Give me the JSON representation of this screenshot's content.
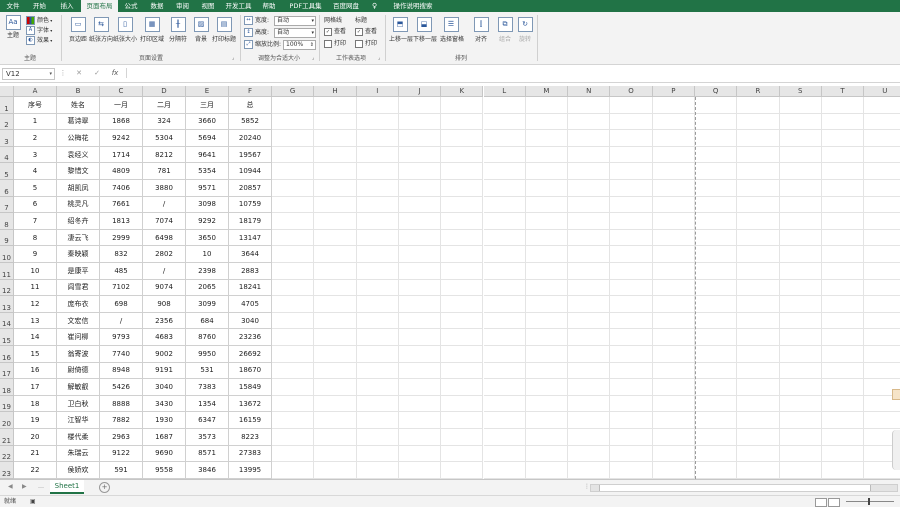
{
  "ribbon": {
    "tabs": [
      "文件",
      "开始",
      "插入",
      "页面布局",
      "公式",
      "数据",
      "审阅",
      "视图",
      "开发工具",
      "帮助",
      "PDF工具集",
      "百度网盘",
      "操作说明搜索"
    ],
    "active_tab": "页面布局",
    "theme_group": {
      "label": "主题",
      "themes_button": "主题",
      "colors": "颜色",
      "fonts": "字体",
      "effects": "效果"
    },
    "page_setup_group": {
      "label": "页面设置",
      "buttons": [
        "页边距",
        "纸张方向",
        "纸张大小",
        "打印区域",
        "分隔符",
        "背景",
        "打印标题"
      ]
    },
    "scale_group": {
      "label": "调整为合适大小",
      "width_label": "宽度:",
      "width_value": "自动",
      "height_label": "高度:",
      "height_value": "自动",
      "scale_label": "缩放比例:",
      "scale_value": "100%"
    },
    "sheet_options_group": {
      "label": "工作表选项",
      "gridlines": "网格线",
      "headings": "标题",
      "view": "查看",
      "print": "打印"
    },
    "arrange_group": {
      "label": "排列",
      "buttons": [
        "上移一层",
        "下移一层",
        "选择窗格",
        "对齐",
        "组合",
        "旋转"
      ]
    }
  },
  "formula_bar": {
    "name_box": "V12",
    "cancel_icon": "✕",
    "enter_icon": "✓",
    "fx": "fx",
    "content": ""
  },
  "grid": {
    "columns": [
      "A",
      "B",
      "C",
      "D",
      "E",
      "F",
      "G",
      "H",
      "I",
      "J",
      "K",
      "L",
      "M",
      "N",
      "O",
      "P",
      "Q",
      "R",
      "S",
      "T",
      "U"
    ],
    "header_row": [
      "序号",
      "姓名",
      "一月",
      "二月",
      "三月",
      "总"
    ],
    "rows": [
      [
        "1",
        "葛诗翠",
        "1868",
        "324",
        "3660",
        "5852"
      ],
      [
        "2",
        "公梅花",
        "9242",
        "5304",
        "5694",
        "20240"
      ],
      [
        "3",
        "袁经义",
        "1714",
        "8212",
        "9641",
        "19567"
      ],
      [
        "4",
        "黎惜文",
        "4809",
        "781",
        "5354",
        "10944"
      ],
      [
        "5",
        "胡凯凤",
        "7406",
        "3880",
        "9571",
        "20857"
      ],
      [
        "6",
        "桃灵凡",
        "7661",
        "/",
        "3098",
        "10759"
      ],
      [
        "7",
        "绍冬卉",
        "1813",
        "7074",
        "9292",
        "18179"
      ],
      [
        "8",
        "凄云飞",
        "2999",
        "6498",
        "3650",
        "13147"
      ],
      [
        "9",
        "秦映颖",
        "832",
        "2802",
        "10",
        "3644"
      ],
      [
        "10",
        "是康平",
        "485",
        "/",
        "2398",
        "2883"
      ],
      [
        "11",
        "闾雪君",
        "7102",
        "9074",
        "2065",
        "18241"
      ],
      [
        "12",
        "庞布衣",
        "698",
        "908",
        "3099",
        "4705"
      ],
      [
        "13",
        "文宏信",
        "/",
        "2356",
        "684",
        "3040"
      ],
      [
        "14",
        "崔问柳",
        "9793",
        "4683",
        "8760",
        "23236"
      ],
      [
        "15",
        "翁寄波",
        "7740",
        "9002",
        "9950",
        "26692"
      ],
      [
        "16",
        "尉倚德",
        "8948",
        "9191",
        "531",
        "18670"
      ],
      [
        "17",
        "解敏叡",
        "5426",
        "3040",
        "7383",
        "15849"
      ],
      [
        "18",
        "卫白秋",
        "8888",
        "3430",
        "1354",
        "13672"
      ],
      [
        "19",
        "江智华",
        "7882",
        "1930",
        "6347",
        "16159"
      ],
      [
        "20",
        "楼代柔",
        "2963",
        "1687",
        "3573",
        "8223"
      ],
      [
        "21",
        "朱瑞云",
        "9122",
        "9690",
        "8571",
        "27383"
      ],
      [
        "22",
        "侯娇欢",
        "591",
        "9558",
        "3846",
        "13995"
      ]
    ]
  },
  "sheets": {
    "tabs": [
      "Sheet1"
    ],
    "add_icon": "+"
  },
  "status": {
    "ready": "就绪"
  },
  "colors": {
    "accent": "#217346",
    "ribbon_bg": "#f3f3f3",
    "header_bg": "#e6e6e6"
  }
}
